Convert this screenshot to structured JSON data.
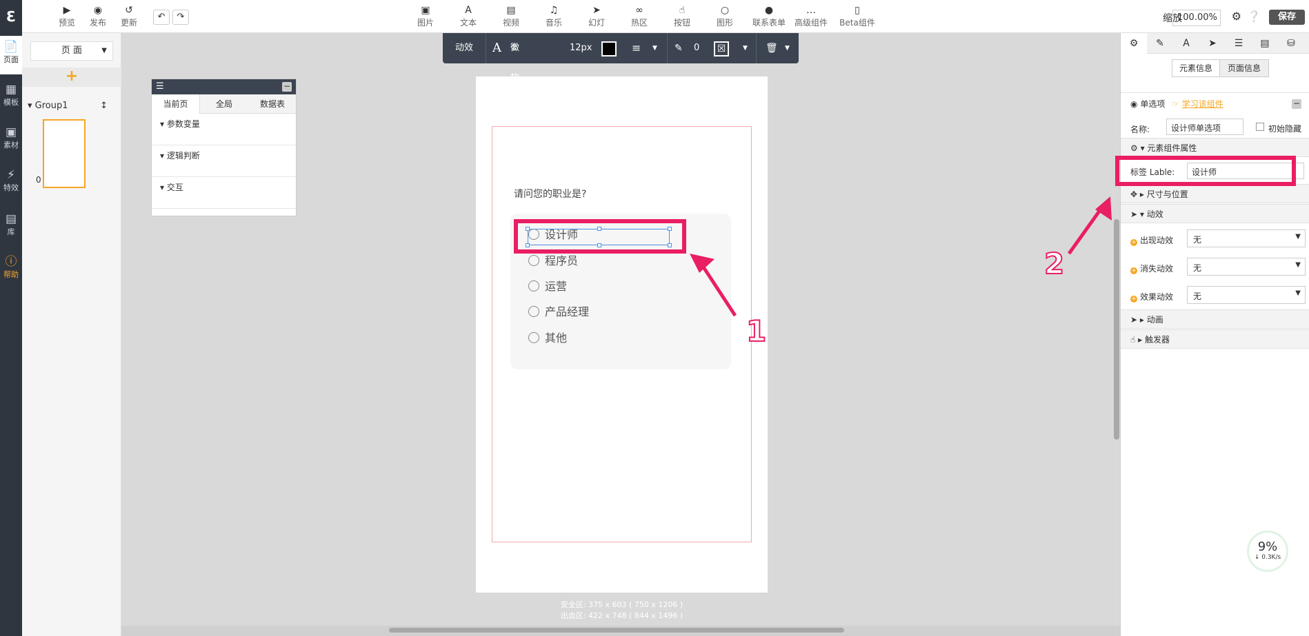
{
  "rail": {
    "items": [
      {
        "label": "页面"
      },
      {
        "label": "模板"
      },
      {
        "label": "素材"
      },
      {
        "label": "特效"
      },
      {
        "label": "库"
      },
      {
        "label": "帮助"
      }
    ]
  },
  "topbar": {
    "left": [
      {
        "label": "预览",
        "icon": "play-icon"
      },
      {
        "label": "发布",
        "icon": "wechat-icon"
      },
      {
        "label": "更新",
        "icon": "refresh-icon"
      }
    ],
    "tools": [
      {
        "label": "图片",
        "icon": "image-icon"
      },
      {
        "label": "文本",
        "icon": "text-icon"
      },
      {
        "label": "视频",
        "icon": "video-icon"
      },
      {
        "label": "音乐",
        "icon": "music-icon"
      },
      {
        "label": "幻灯",
        "icon": "slideshow-icon"
      },
      {
        "label": "热区",
        "icon": "link-icon"
      },
      {
        "label": "按钮",
        "icon": "pointer-icon"
      },
      {
        "label": "图形",
        "icon": "circle-icon"
      },
      {
        "label": "联系表单",
        "icon": "user-icon"
      },
      {
        "label": "高级组件",
        "icon": "more-icon"
      },
      {
        "label": "Beta组件",
        "icon": "phone-icon"
      }
    ],
    "zoom_label": "缩放",
    "zoom_value": "100.00%",
    "save_label": "保存"
  },
  "pages_panel": {
    "select_value": "页 面",
    "group_name": "Group1",
    "thumb_index": "0"
  },
  "data_panel": {
    "tabs": [
      "当前页",
      "全局",
      "数据表"
    ],
    "sections": [
      "参数变量",
      "逻辑判断",
      "交互"
    ]
  },
  "format_bar": {
    "effect": "动效",
    "font": "微软雅黑",
    "size": "12px",
    "stroke_width": "0"
  },
  "phone": {
    "question": "请问您的职业是?",
    "options": [
      "设计师",
      "程序员",
      "运营",
      "产品经理",
      "其他"
    ],
    "safe_area": "安全区: 375 x 603 ( 750 x 1206 )",
    "bleed_area": "出血区: 422 x 748 ( 844 x 1496 )"
  },
  "annotations": {
    "one": "1",
    "two": "2"
  },
  "props": {
    "seg": [
      "元素信息",
      "页面信息"
    ],
    "component_type": "单选项",
    "learn_link": "学习该组件",
    "name_label": "名称:",
    "name_value": "设计师单选项",
    "init_hidden": "初始隐藏",
    "sect_attrs": "元素组件属性",
    "label_label": "标签 Lable:",
    "label_value": "设计师",
    "sect_size": "尺寸与位置",
    "sect_effect": "动效",
    "appear": "出现动效",
    "disappear": "消失动效",
    "effect": "效果动效",
    "none": "无",
    "sect_anim": "动画",
    "sect_trigger": "触发器"
  },
  "speed_widget": {
    "percent": "9%",
    "rate": "0.3K/s"
  },
  "colors": {
    "accent": "#ea1e63",
    "orange": "#f5a623",
    "dark": "#2f3640"
  }
}
